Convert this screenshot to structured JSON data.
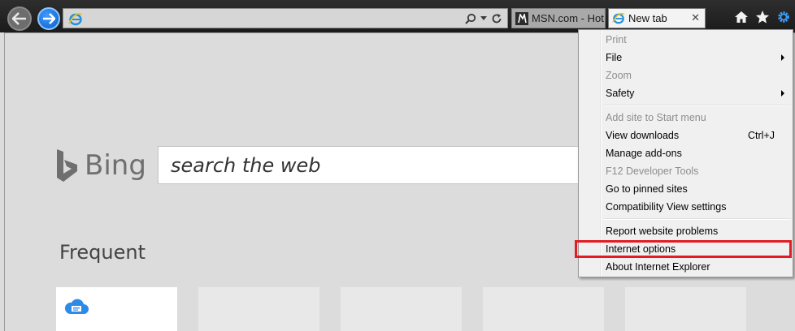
{
  "browser": {
    "tabs": [
      {
        "label": "MSN.com - Hot...",
        "icon": "msn-icon",
        "active": false
      },
      {
        "label": "New tab",
        "icon": "ie-icon",
        "active": true
      }
    ],
    "address": {
      "value": ""
    },
    "tab_close_glyph": "✕"
  },
  "content": {
    "bing_label": "Bing",
    "search_placeholder": "search the web",
    "frequent_label": "Frequent"
  },
  "tools_menu": {
    "items": [
      {
        "label": "Print",
        "enabled": false
      },
      {
        "label": "File",
        "enabled": true,
        "submenu": true
      },
      {
        "label": "Zoom",
        "enabled": false
      },
      {
        "label": "Safety",
        "enabled": true,
        "submenu": true
      },
      {
        "label": "Add site to Start menu",
        "enabled": false
      },
      {
        "label": "View downloads",
        "enabled": true,
        "shortcut": "Ctrl+J"
      },
      {
        "label": "Manage add-ons",
        "enabled": true
      },
      {
        "label": "F12 Developer Tools",
        "enabled": false
      },
      {
        "label": "Go to pinned sites",
        "enabled": true
      },
      {
        "label": "Compatibility View settings",
        "enabled": true
      },
      {
        "label": "Report website problems",
        "enabled": true
      },
      {
        "label": "Internet options",
        "enabled": true,
        "highlighted": true
      },
      {
        "label": "About Internet Explorer",
        "enabled": true
      }
    ]
  },
  "colors": {
    "highlight": "#e31b23",
    "chrome_bg": "#222222",
    "page_bg": "#dcdcdc"
  }
}
